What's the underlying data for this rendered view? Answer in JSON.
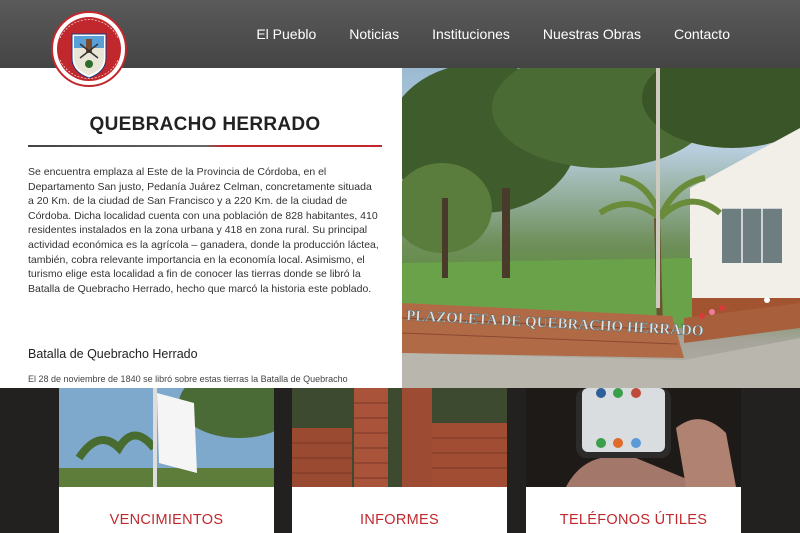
{
  "header": {
    "nav": [
      "El Pueblo",
      "Noticias",
      "Instituciones",
      "Nuestras Obras",
      "Contacto"
    ]
  },
  "intro": {
    "title": "QUEBRACHO HERRADO",
    "description": "Se encuentra emplaza al Este de la Provincia de Córdoba, en el Departamento San justo, Pedanía Juárez Celman, concretamente situada a 20 Km. de la ciudad de San Francisco y a 220 Km. de la ciudad de Córdoba. Dicha localidad cuenta con una población de 828 habitantes, 410 residentes instalados en la zona urbana y 418 en zona rural. Su principal actividad económica es la agrícola – ganadera, donde la producción láctea, también, cobra relevante importancia en la economía local. Asimismo, el turismo elige esta localidad a fin de conocer las tierras donde se libró la Batalla de Quebracho Herrado, hecho que marcó la historia este poblado.",
    "section_title": "Batalla de Quebracho Herrado",
    "section_snippet": "El 28 de noviembre de 1840 se libró sobre estas tierras la Batalla de Quebracho"
  },
  "hero": {
    "sign_text": "PLAZOLETA DE QUEBRACHO HERRADO"
  },
  "cards": [
    {
      "label": "VENCIMIENTOS"
    },
    {
      "label": "INFORMES"
    },
    {
      "label": "TELÉFONOS ÚTILES"
    }
  ],
  "colors": {
    "accent": "#c0282d",
    "header": "#4a4a4a"
  }
}
